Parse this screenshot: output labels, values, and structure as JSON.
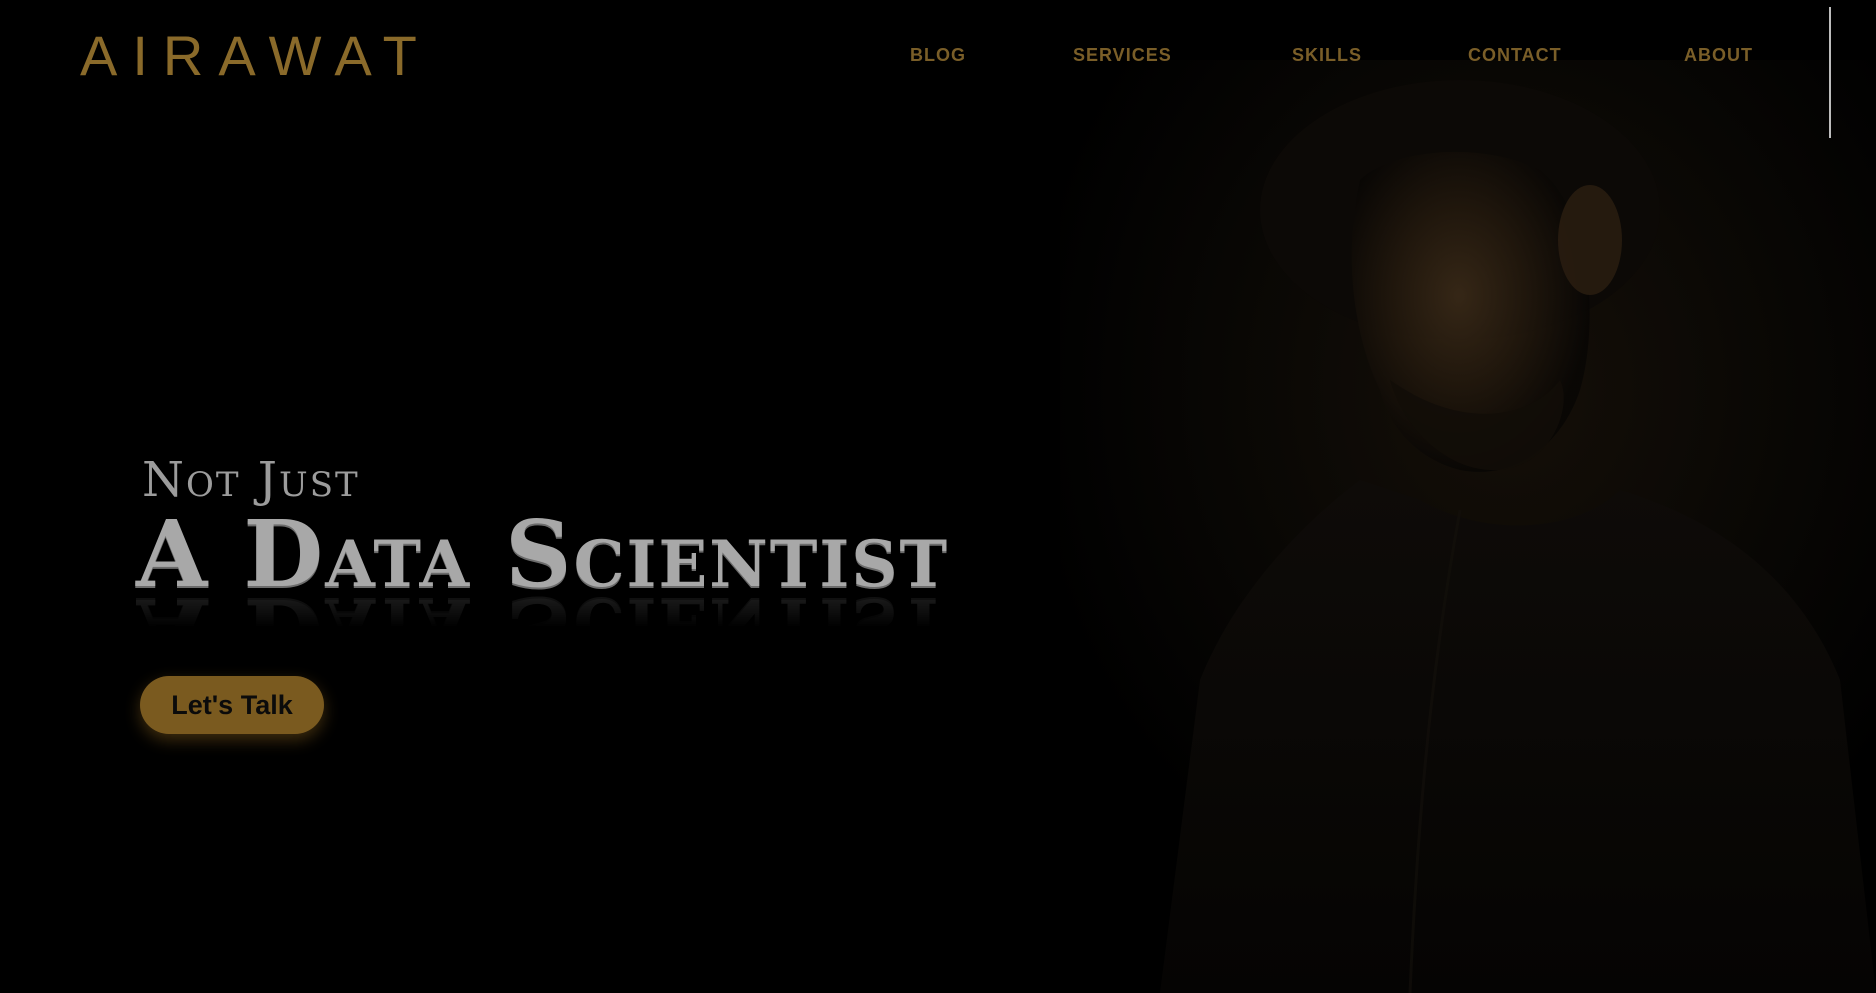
{
  "brand": {
    "logo": "AIRAWAT"
  },
  "nav": {
    "items": [
      {
        "label": "BLOG"
      },
      {
        "label": "SERVICES"
      },
      {
        "label": "SKILLS"
      },
      {
        "label": "CONTACT"
      },
      {
        "label": "ABOUT"
      }
    ]
  },
  "hero": {
    "tagline": "Not Just",
    "headline": "A Data Scientist",
    "cta_label": "Let's Talk"
  },
  "theme": {
    "accent": "#7a5a1f",
    "nav_color": "#7a5e28",
    "background": "#000000",
    "headline_color": "#a8a8a8"
  },
  "icons": {
    "menu": "menu-line-icon"
  }
}
